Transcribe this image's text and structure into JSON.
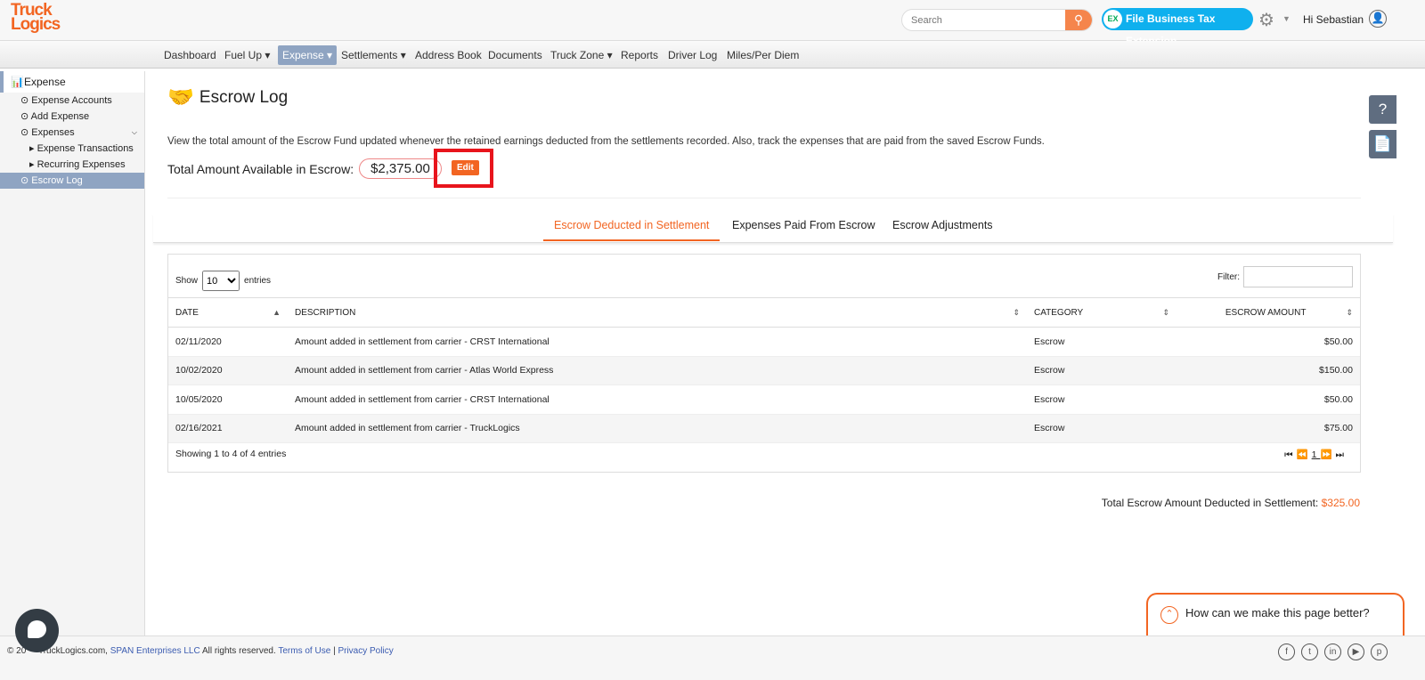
{
  "header": {
    "logo": "TruckLogics",
    "search_placeholder": "Search",
    "tax_button": "File Business Tax Extension",
    "tax_icon_text": "EX",
    "greeting": "Hi Sebastian"
  },
  "nav": [
    "Dashboard",
    "Fuel Up ▾",
    "Expense ▾",
    "Settlements ▾",
    "Address Book",
    "Documents",
    "Truck Zone ▾",
    "Reports",
    "Driver Log",
    "Miles/Per Diem"
  ],
  "sidebar": {
    "header": "Expense",
    "items": [
      {
        "label": "Expense Accounts"
      },
      {
        "label": "Add Expense"
      },
      {
        "label": "Expenses"
      },
      {
        "label": "Expense Transactions"
      },
      {
        "label": "Recurring Expenses"
      },
      {
        "label": "Escrow Log"
      }
    ]
  },
  "page": {
    "title": "Escrow Log",
    "description": "View the total amount of the Escrow Fund updated whenever the retained earnings deducted from the settlements recorded. Also, track the expenses that are paid from the saved Escrow Funds.",
    "total_label": "Total Amount Available in Escrow:",
    "total_value": "$2,375.00",
    "edit_label": "Edit"
  },
  "tabs": [
    "Escrow Deducted in Settlement",
    "Expenses Paid From Escrow",
    "Escrow Adjustments"
  ],
  "table": {
    "show_label": "Show",
    "entries_value": "10",
    "entries_label": "entries",
    "filter_label": "Filter:",
    "columns": [
      "DATE",
      "DESCRIPTION",
      "CATEGORY",
      "ESCROW AMOUNT"
    ],
    "rows": [
      [
        "02/11/2020",
        "Amount added in settlement from carrier - CRST International",
        "Escrow",
        "$50.00"
      ],
      [
        "10/02/2020",
        "Amount added in settlement from carrier - Atlas World Express",
        "Escrow",
        "$150.00"
      ],
      [
        "10/05/2020",
        "Amount added in settlement from carrier - CRST International",
        "Escrow",
        "$50.00"
      ],
      [
        "02/16/2021",
        "Amount added in settlement from carrier - TruckLogics",
        "Escrow",
        "$75.00"
      ]
    ],
    "info": "Showing 1 to 4 of 4 entries",
    "page": "1"
  },
  "summary": {
    "label": "Total Escrow Amount Deducted in Settlement:",
    "value": "$325.00"
  },
  "feedback": "How can we make this page better?",
  "footer": {
    "copyright": "© 20     TruckLogics.com,",
    "company": "SPAN Enterprises LLC",
    "rights": "All rights reserved.",
    "terms": "Terms of Use",
    "sep": "|",
    "privacy": "Privacy Policy",
    "social": [
      "facebook",
      "twitter",
      "linkedin",
      "youtube",
      "pinterest"
    ]
  },
  "colors": {
    "accent": "#f26522",
    "nav_active": "#8fa4c2",
    "tax_button": "#0fb0ee"
  }
}
